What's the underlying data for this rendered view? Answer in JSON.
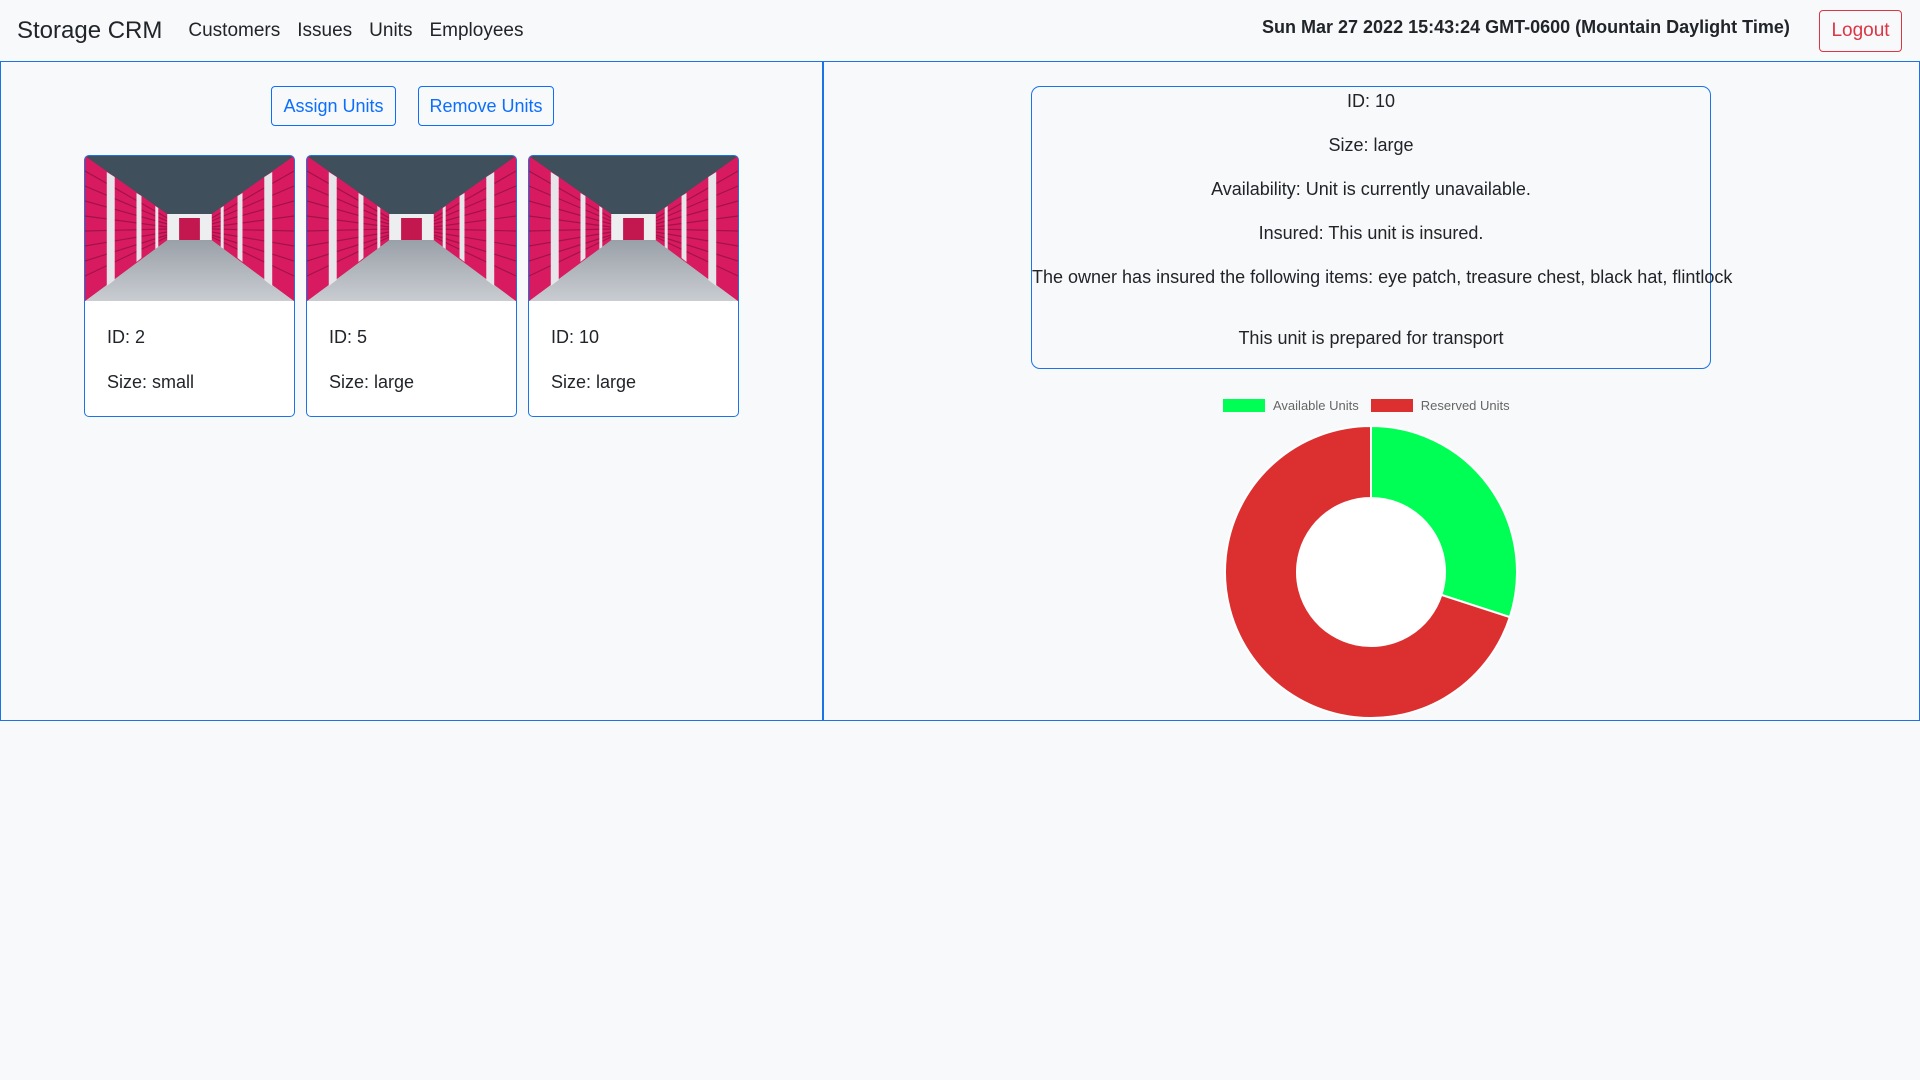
{
  "navbar": {
    "brand": "Storage CRM",
    "links": [
      "Customers",
      "Issues",
      "Units",
      "Employees"
    ],
    "datetime": "Sun Mar 27 2022 15:43:24 GMT-0600 (Mountain Daylight Time)",
    "logout_label": "Logout"
  },
  "units_panel": {
    "assign_label": "Assign Units",
    "remove_label": "Remove Units",
    "cards": [
      {
        "id_text": "ID: 2",
        "size_text": "Size: small"
      },
      {
        "id_text": "ID: 5",
        "size_text": "Size: large"
      },
      {
        "id_text": "ID: 10",
        "size_text": "Size: large"
      }
    ]
  },
  "details": {
    "id_text": "ID: 10",
    "size_text": "Size: large",
    "availability_text": "Availability: Unit is currently unavailable.",
    "insured_text": "Insured: This unit is insured.",
    "items_text": "The owner has insured the following items: eye patch, treasure chest, black hat, flintlock",
    "transport_text": "This unit is prepared for transport"
  },
  "chart_data": {
    "type": "doughnut",
    "categories": [
      "Available Units",
      "Reserved Units"
    ],
    "values": [
      3,
      7
    ],
    "colors": [
      "#00ff55",
      "#dc3030"
    ],
    "legend_position": "top",
    "title": ""
  },
  "colors": {
    "accent": "#0d6efd",
    "panel_border": "#1a73e8",
    "danger": "#dc3545",
    "background": "#f8f9fa"
  }
}
